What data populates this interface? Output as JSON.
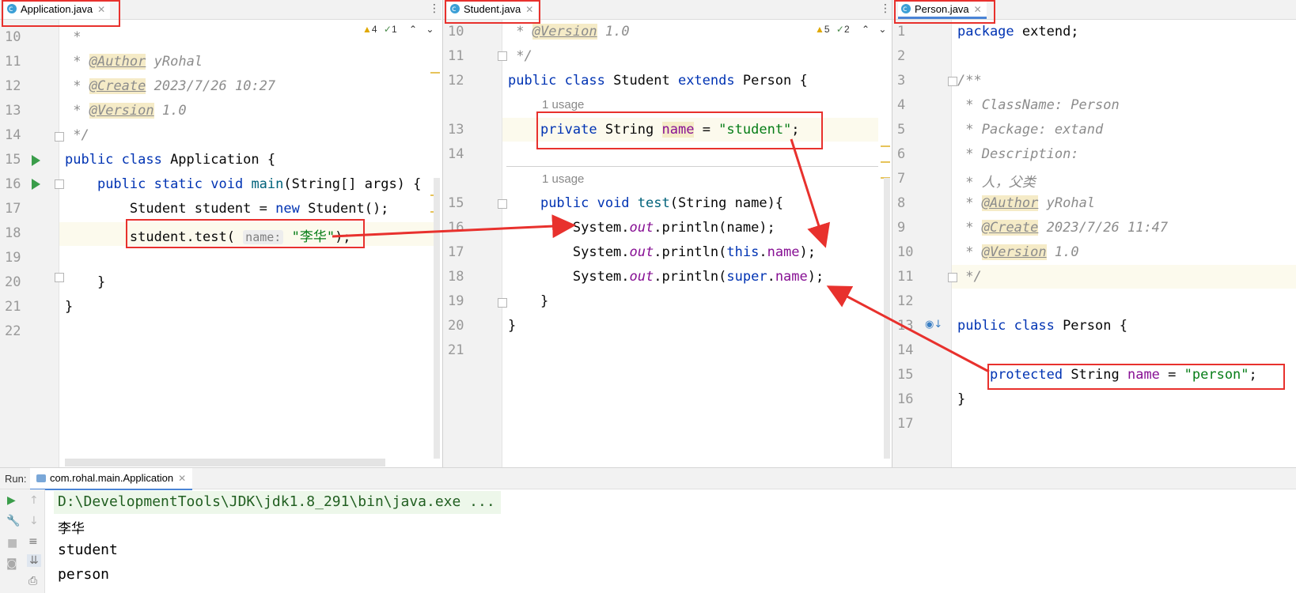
{
  "panes": {
    "application": {
      "tab": "Application.java",
      "inspections": {
        "warnings": "4",
        "ok": "1"
      },
      "lines": [
        {
          "n": "10",
          "html": " <span class=\"cm\">*</span>"
        },
        {
          "n": "11",
          "html": " <span class=\"cm\">* </span><span class=\"tag\">@Author</span><span class=\"cm\"> yRohal</span>"
        },
        {
          "n": "12",
          "html": " <span class=\"cm\">* </span><span class=\"tag\">@Create</span><span class=\"cm\"> 2023/7/26 10:27</span>"
        },
        {
          "n": "13",
          "html": " <span class=\"cm\">* </span><span class=\"tag\">@Version</span><span class=\"cm\"> 1.0</span>"
        },
        {
          "n": "14",
          "html": " <span class=\"cm\">*/</span>"
        },
        {
          "n": "15",
          "html": "<span class=\"kw\">public class</span> Application {"
        },
        {
          "n": "16",
          "html": "    <span class=\"kw\">public static void</span> <span class=\"fn\">main</span>(String[] args) {"
        },
        {
          "n": "17",
          "html": "        Student student = <span class=\"kw\">new</span> Student();"
        },
        {
          "n": "18",
          "html": "        student.test( <span class=\"hint\">name:</span> <span class=\"str\">\"李华\"</span>);"
        },
        {
          "n": "19",
          "html": ""
        },
        {
          "n": "20",
          "html": "    }"
        },
        {
          "n": "21",
          "html": "}"
        },
        {
          "n": "22",
          "html": ""
        }
      ]
    },
    "student": {
      "tab": "Student.java",
      "inspections": {
        "warnings": "5",
        "ok": "2"
      },
      "usage_label": "1 usage",
      "lines": [
        {
          "n": "10",
          "html": " <span class=\"cm\">* </span><span class=\"tag\">@Version</span><span class=\"cm\"> 1.0</span>"
        },
        {
          "n": "11",
          "html": " <span class=\"cm\">*/</span>"
        },
        {
          "n": "12",
          "html": "<span class=\"kw\">public class</span> Student <span class=\"kw\">extends</span> Person {"
        },
        {
          "n": "13",
          "html": "    <span class=\"kw\">private</span> String <span class=\"fld\" style=\"background:#f5ebc7\">name</span> = <span class=\"str\">\"student\"</span>;"
        },
        {
          "n": "14",
          "html": ""
        },
        {
          "n": "15",
          "html": "    <span class=\"kw\">public void</span> <span class=\"fn\">test</span>(String name){"
        },
        {
          "n": "16",
          "html": "        System.<span class=\"stat\">out</span>.println(name);"
        },
        {
          "n": "17",
          "html": "        System.<span class=\"stat\">out</span>.println(<span class=\"kw\">this</span>.<span class=\"fld\">name</span>);"
        },
        {
          "n": "18",
          "html": "        System.<span class=\"stat\">out</span>.println(<span class=\"kw\">super</span>.<span class=\"fld\">name</span>);"
        },
        {
          "n": "19",
          "html": "    }"
        },
        {
          "n": "20",
          "html": "}"
        },
        {
          "n": "21",
          "html": ""
        }
      ]
    },
    "person": {
      "tab": "Person.java",
      "lines": [
        {
          "n": "1",
          "html": "<span class=\"kw\">package</span> extend;"
        },
        {
          "n": "2",
          "html": ""
        },
        {
          "n": "3",
          "html": "<span class=\"cm\">/**</span>"
        },
        {
          "n": "4",
          "html": " <span class=\"cm\">* ClassName: Person</span>"
        },
        {
          "n": "5",
          "html": " <span class=\"cm\">* Package: extand</span>"
        },
        {
          "n": "6",
          "html": " <span class=\"cm\">* Description:</span>"
        },
        {
          "n": "7",
          "html": " <span class=\"cm\">* 人，父类</span>"
        },
        {
          "n": "8",
          "html": " <span class=\"cm\">* </span><span class=\"tag\">@Author</span><span class=\"cm\"> yRohal</span>"
        },
        {
          "n": "9",
          "html": " <span class=\"cm\">* </span><span class=\"tag\">@Create</span><span class=\"cm\"> 2023/7/26 11:47</span>"
        },
        {
          "n": "10",
          "html": " <span class=\"cm\">* </span><span class=\"tag\">@Version</span><span class=\"cm\"> 1.0</span>"
        },
        {
          "n": "11",
          "html": " <span class=\"cm\">*/</span>"
        },
        {
          "n": "12",
          "html": ""
        },
        {
          "n": "13",
          "html": "<span class=\"kw\">public class</span> Person {"
        },
        {
          "n": "14",
          "html": ""
        },
        {
          "n": "15",
          "html": "    <span class=\"kw\">protected</span> String <span class=\"fld\">name</span> = <span class=\"str\">\"person\"</span>;"
        },
        {
          "n": "16",
          "html": "}"
        },
        {
          "n": "17",
          "html": ""
        }
      ]
    }
  },
  "run": {
    "label": "Run:",
    "config": "com.rohal.main.Application",
    "output": [
      "D:\\DevelopmentTools\\JDK\\jdk1.8_291\\bin\\java.exe ...",
      "李华",
      "student",
      "person"
    ]
  },
  "colors": {
    "annotation_red": "#e8312d",
    "keyword": "#0033b3",
    "string": "#067d17",
    "field": "#871094"
  }
}
